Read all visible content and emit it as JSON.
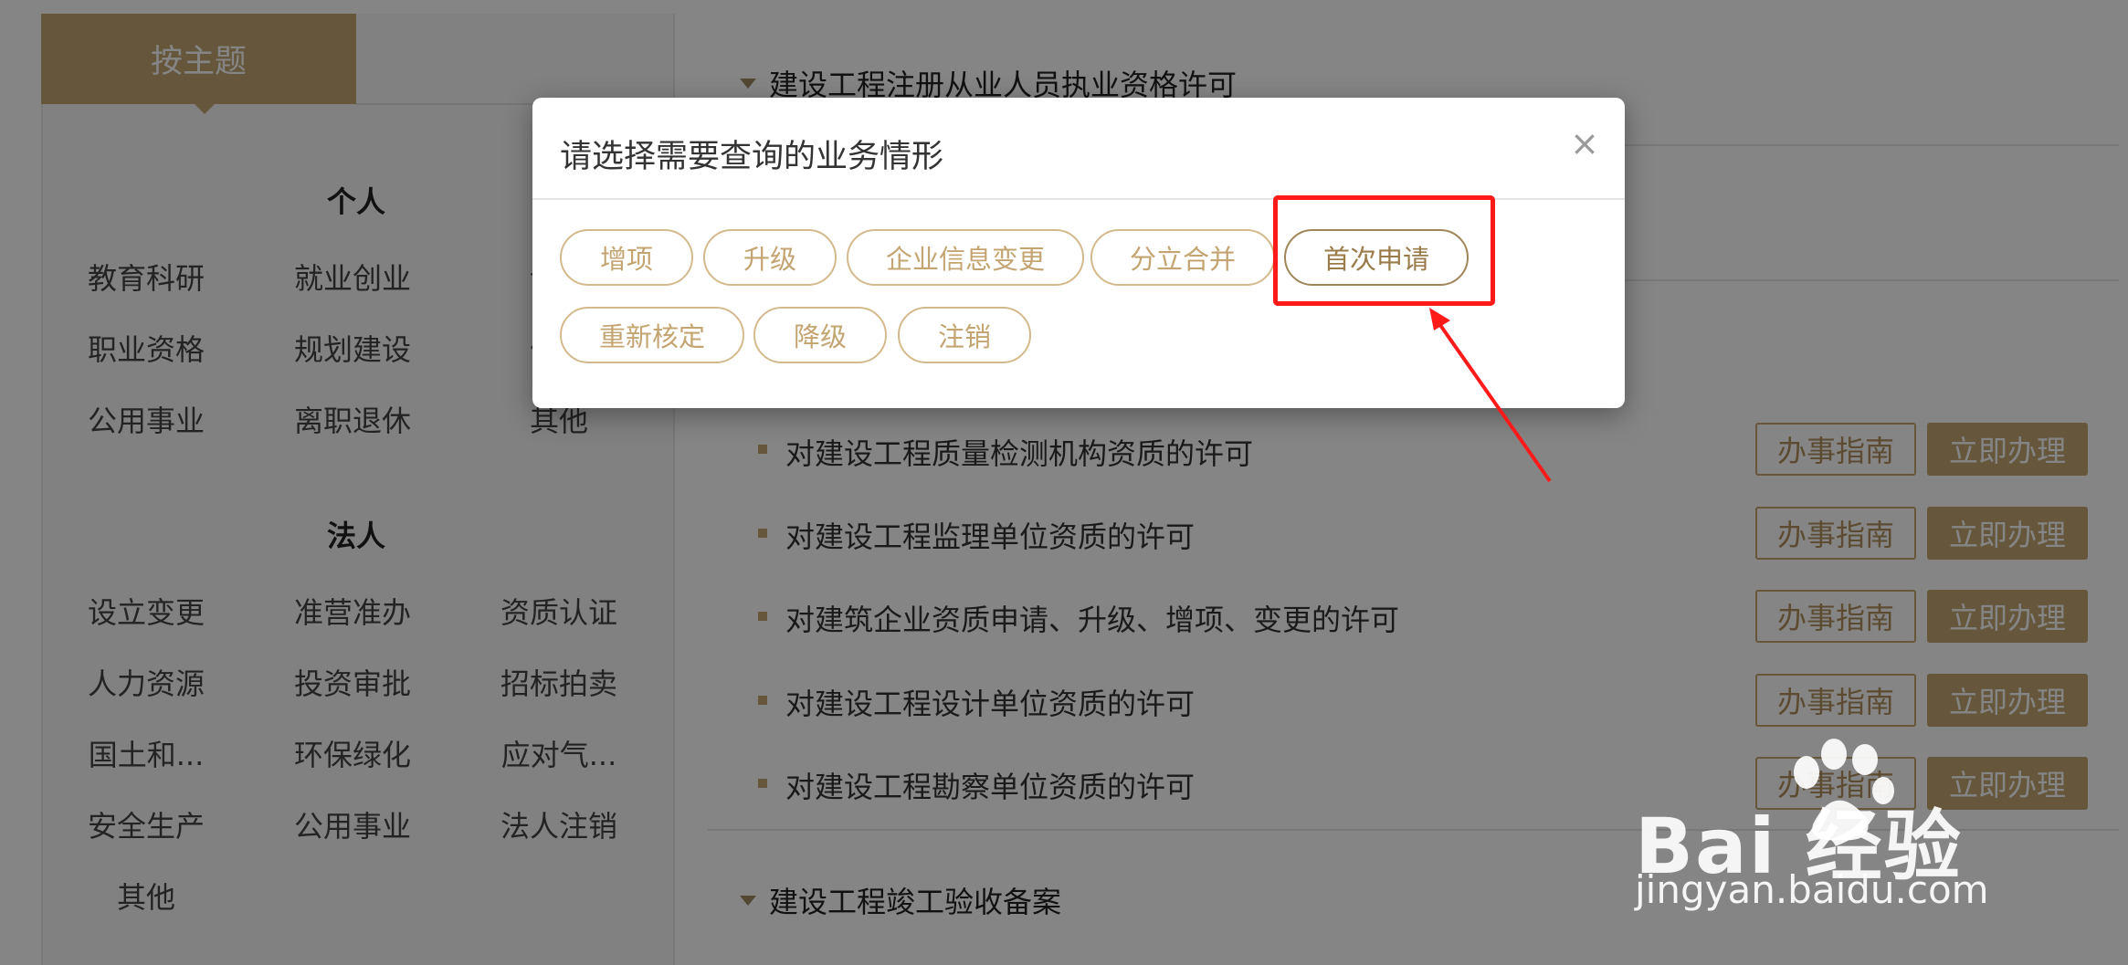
{
  "sidebar": {
    "tab_label": "按主题",
    "personal": {
      "title": "个人",
      "items": [
        "教育科研",
        "就业创业",
        "设…",
        "职业资格",
        "规划建设",
        "住…",
        "公用事业",
        "离职退休",
        "其他"
      ]
    },
    "legal": {
      "title": "法人",
      "items": [
        "设立变更",
        "准营准办",
        "资质认证",
        "人力资源",
        "投资审批",
        "招标拍卖",
        "国土和...",
        "环保绿化",
        "应对气...",
        "安全生产",
        "公用事业",
        "法人注销",
        "其他"
      ]
    }
  },
  "main": {
    "section1_title": "建设工程注册从业人员执业资格许可",
    "rows": [
      {
        "text": "对建设工程质量检测机构资质的许可"
      },
      {
        "text": "对建设工程监理单位资质的许可"
      },
      {
        "text": "对建筑企业资质申请、升级、增项、变更的许可"
      },
      {
        "text": "对建设工程设计单位资质的许可"
      },
      {
        "text": "对建设工程勘察单位资质的许可"
      }
    ],
    "guide_label": "办事指南",
    "do_label": "立即办理",
    "section2_title": "建设工程竣工验收备案"
  },
  "modal": {
    "title": "请选择需要查询的业务情形",
    "close": "×",
    "options": [
      "增项",
      "升级",
      "企业信息变更",
      "分立合并",
      "首次申请",
      "重新核定",
      "降级",
      "注销"
    ],
    "highlighted_option": "首次申请"
  },
  "watermark": {
    "logo": "Bai  经验",
    "sub": "jingyan.baidu.com"
  },
  "colors": {
    "accent": "#c4a572",
    "annotation": "#ff1a1a",
    "overlay": "rgba(0,0,0,0.48)"
  }
}
